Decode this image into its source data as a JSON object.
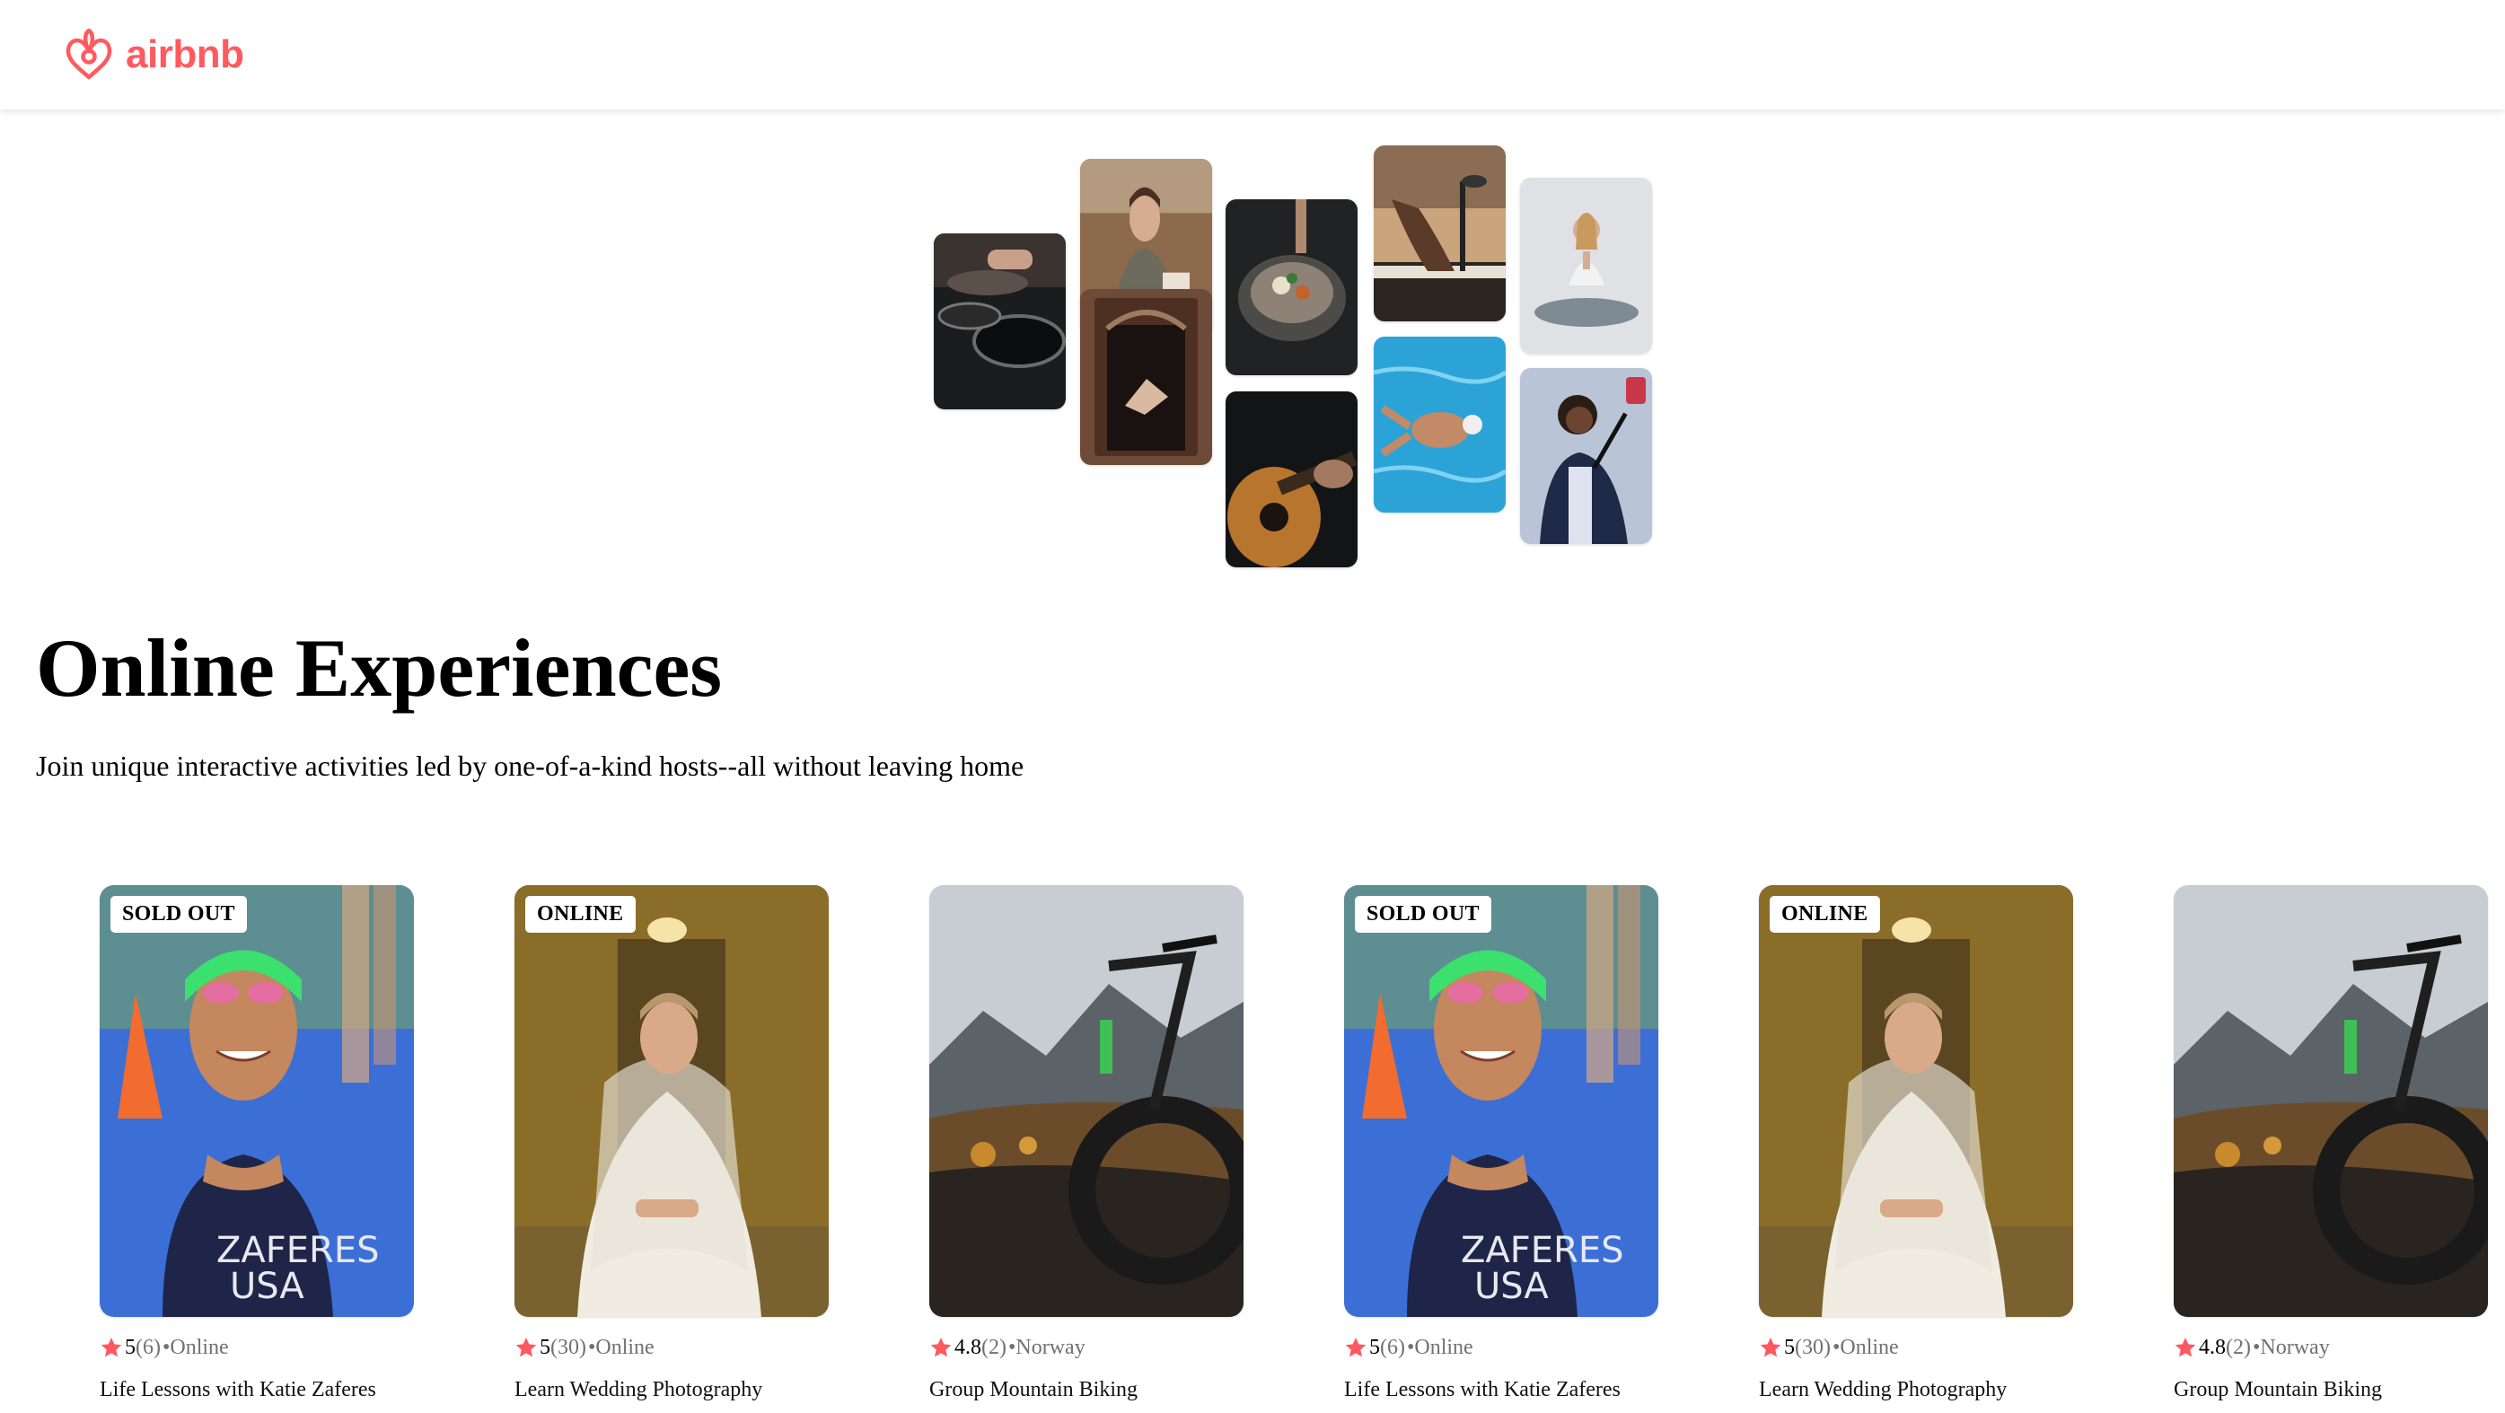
{
  "brand": {
    "name": "airbnb",
    "color": "#ff5a5f",
    "icon": "airbnb-belo-logo-icon"
  },
  "hero": {
    "title": "Online Experiences",
    "subtitle": "Join unique interactive activities led by one-of-a-kind hosts--all without leaving home"
  },
  "collage": [
    {
      "subject": "cooking-pans-photo"
    },
    {
      "subject": "barista-woman-photo"
    },
    {
      "subject": "doorway-dancer-photo"
    },
    {
      "subject": "food-bowl-photo"
    },
    {
      "subject": "acoustic-guitar-photo"
    },
    {
      "subject": "piano-microphone-photo"
    },
    {
      "subject": "swimmer-pool-photo"
    },
    {
      "subject": "yoga-woman-photo"
    },
    {
      "subject": "singer-performer-photo"
    }
  ],
  "cards": [
    {
      "badge": "SOLD OUT",
      "rating": "5",
      "reviews": "(6)",
      "separator": " •",
      "location": "Online",
      "title": "Life Lessons with Katie Zaferes",
      "photo": "triathlete"
    },
    {
      "badge": "ONLINE",
      "rating": "5",
      "reviews": "(30)",
      "separator": " •",
      "location": "Online",
      "title": "Learn Wedding Photography",
      "photo": "bride"
    },
    {
      "badge": "",
      "rating": "4.8",
      "reviews": "(2)",
      "separator": " •",
      "location": "Norway",
      "title": "Group Mountain Biking",
      "photo": "bike"
    },
    {
      "badge": "SOLD OUT",
      "rating": "5",
      "reviews": "(6)",
      "separator": " •",
      "location": "Online",
      "title": "Life Lessons with Katie Zaferes",
      "photo": "triathlete"
    },
    {
      "badge": "ONLINE",
      "rating": "5",
      "reviews": "(30)",
      "separator": " •",
      "location": "Online",
      "title": "Learn Wedding Photography",
      "photo": "bride"
    },
    {
      "badge": "",
      "rating": "4.8",
      "reviews": "(2)",
      "separator": " •",
      "location": "Norway",
      "title": "Group Mountain Biking",
      "photo": "bike"
    }
  ],
  "colors": {
    "star": "#fe595e",
    "muted": "#717171"
  }
}
